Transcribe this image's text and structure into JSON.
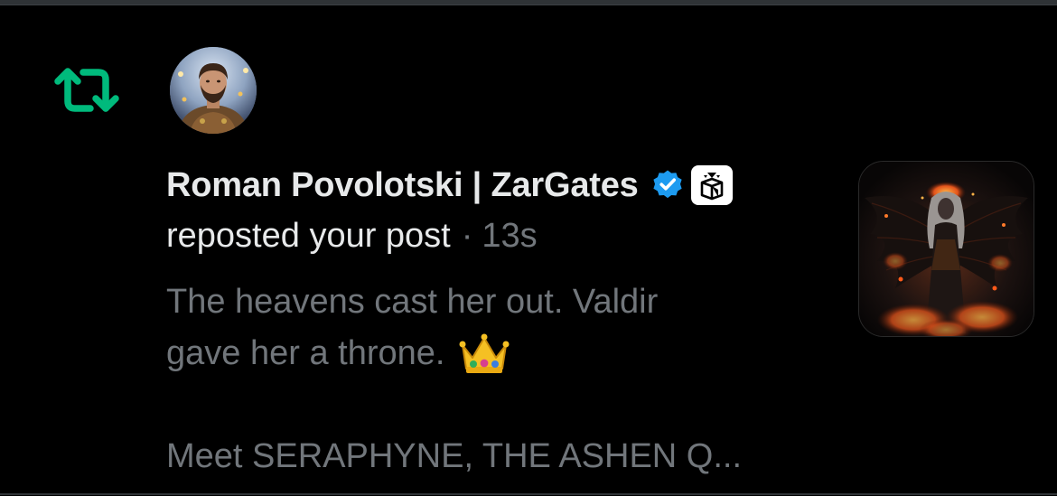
{
  "notification": {
    "type_icon": "repost-icon",
    "accent_color": "#00ba7c",
    "user": {
      "display_name": "Roman Povolotski | ZarGates",
      "avatar_icon": "avatar",
      "verified_icon": "verified-badge-icon",
      "verified_color": "#1d9bf0",
      "affiliate_icon": "affiliate-badge-icon"
    },
    "action_text": "reposted your post",
    "separator": "·",
    "time_ago": "13s",
    "post": {
      "line1": "The heavens cast her out. Valdir",
      "line2": "gave her a throne.",
      "emoji_icon": "crown-icon",
      "line3": "Meet SERAPHYNE, THE ASHEN Q..."
    },
    "media_icon": "post-thumbnail-image"
  },
  "colors": {
    "background": "#000000",
    "primary_text": "#e7e9ea",
    "secondary_text": "#71767b",
    "divider": "#2f3336"
  }
}
